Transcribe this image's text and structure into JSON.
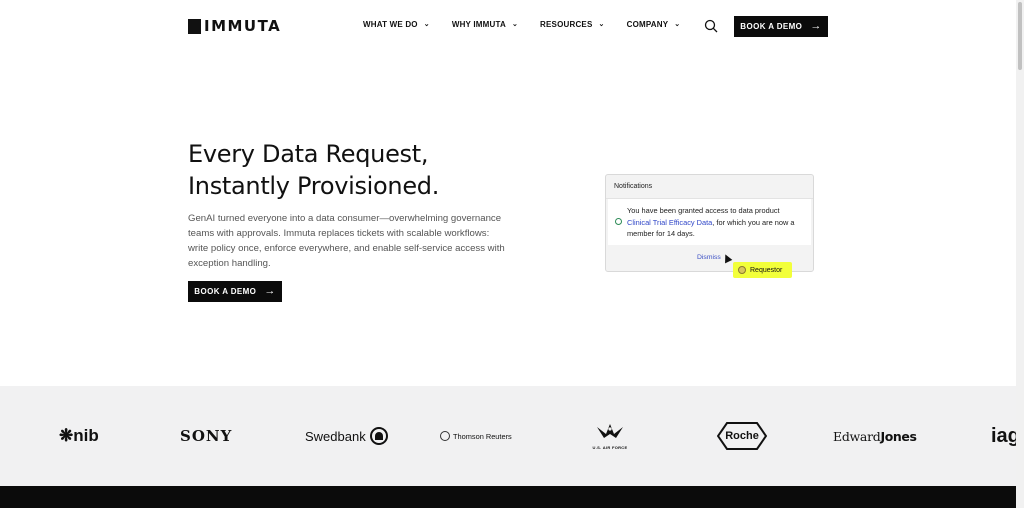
{
  "header": {
    "logo_text": "IMMUTA",
    "nav": [
      {
        "label": "WHAT WE DO"
      },
      {
        "label": "WHY IMMUTA"
      },
      {
        "label": "RESOURCES"
      },
      {
        "label": "COMPANY"
      }
    ],
    "cta_label": "BOOK A DEMO"
  },
  "hero": {
    "title_line1": "Every Data Request,",
    "title_line2": "Instantly Provisioned.",
    "description": "GenAI turned everyone into a data consumer—overwhelming governance teams with approvals. Immuta replaces tickets with scalable workflows: write policy once, enforce everywhere, and enable self-service access with exception handling.",
    "cta_label": "BOOK A DEMO"
  },
  "notification": {
    "header": "Notifications",
    "text_before": "You have been granted access to data product ",
    "link_text": "Clinical Trial Efficacy Data",
    "text_after": ", for which you are now a member for 14 days.",
    "dismiss_label": "Dismiss",
    "tag_label": "Requestor",
    "tag_color": "#f2ff3a"
  },
  "logos": {
    "nib": "nib",
    "sony": "SONY",
    "swedbank": "Swedbank",
    "thomson_reuters": "Thomson Reuters",
    "air_force": "U.S. AIR FORCE",
    "roche": "Roche",
    "edward_jones_first": "Edward",
    "edward_jones_second": "Jones",
    "iag": "iag"
  },
  "colors": {
    "button_bg": "#0b0b0b",
    "logo_band_bg": "#f1f1f2",
    "link": "#2f46c8"
  }
}
